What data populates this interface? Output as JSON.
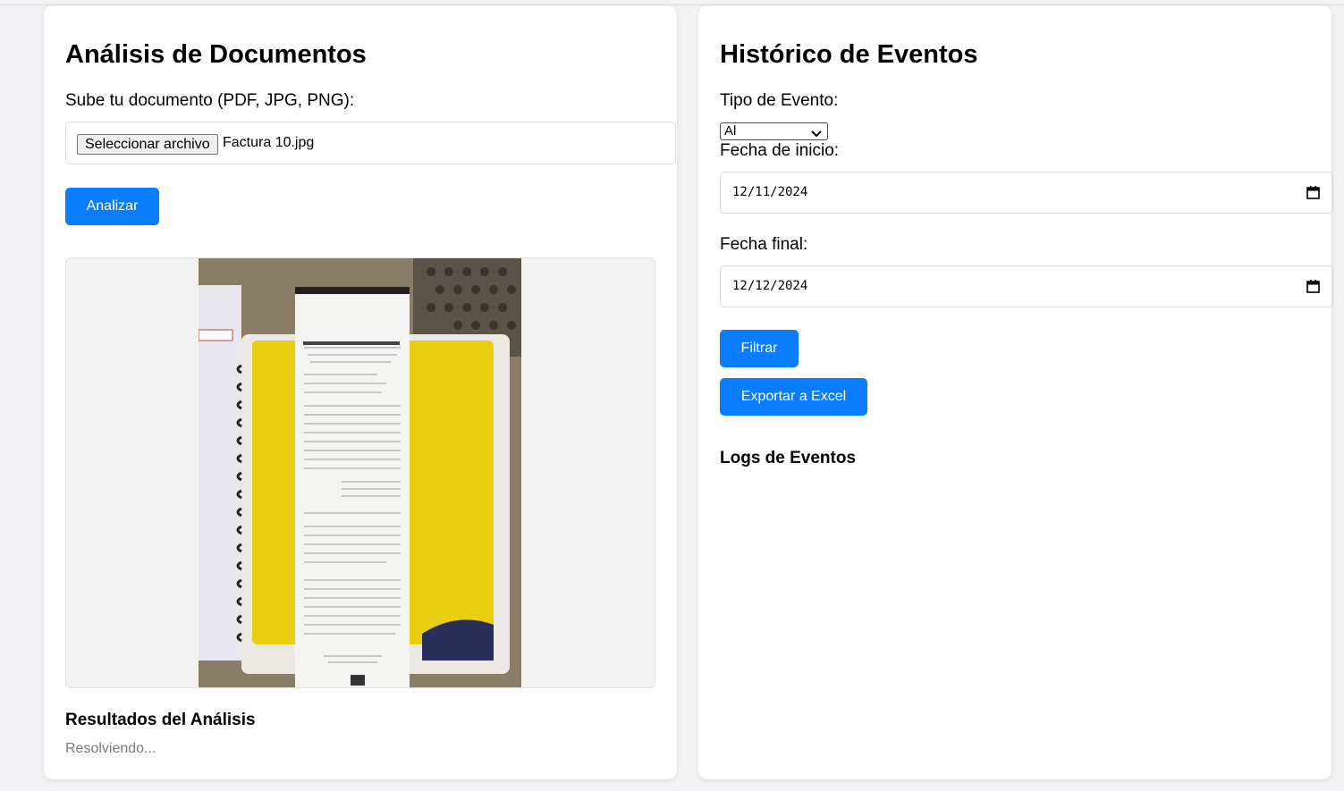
{
  "left": {
    "title": "Análisis de Documentos",
    "upload_label": "Sube tu documento (PDF, JPG, PNG):",
    "file_button": "Seleccionar archivo",
    "file_name": "Factura 10.jpg",
    "analyze_button": "Analizar",
    "results_heading": "Resultados del Análisis",
    "results_status": "Resolviendo..."
  },
  "right": {
    "title": "Histórico de Eventos",
    "event_type_label": "Tipo de Evento:",
    "event_type_value": "Al",
    "start_label": "Fecha de inicio:",
    "start_value": "12/11/2024",
    "end_label": "Fecha final:",
    "end_value": "12/12/2024",
    "filter_button": "Filtrar",
    "export_button": "Exportar a Excel",
    "logs_heading": "Logs de Eventos"
  },
  "icons": {
    "select_arrow": "chevron-down-icon",
    "calendar": "calendar-icon"
  },
  "colors": {
    "primary": "#0a7cff",
    "card": "#ffffff",
    "background": "#f3f3f5"
  }
}
